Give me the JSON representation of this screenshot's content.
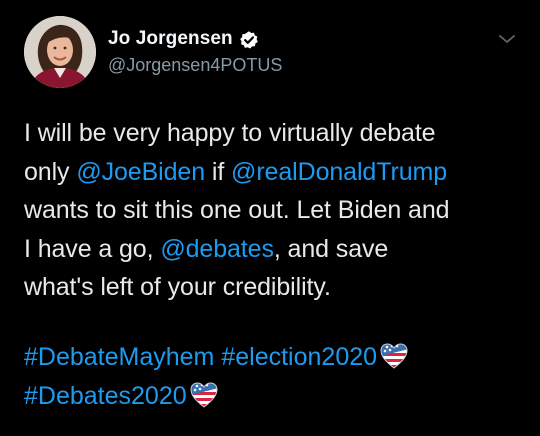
{
  "author": {
    "name": "Jo Jorgensen",
    "handle": "@Jorgensen4POTUS",
    "verified": true
  },
  "tweet": {
    "line1": "I will be very happy to virtually debate",
    "line2_pre": "only ",
    "mention1": "@JoeBiden",
    "line2_mid": " if ",
    "mention2": "@realDonaldTrump",
    "line3": "wants to sit this one out. Let Biden and",
    "line4_pre": "I have a go, ",
    "mention3": "@debates",
    "line4_post": ", and save",
    "line5": "what's left of your credibility."
  },
  "hashtags": {
    "tag1": "#DebateMayhem",
    "tag2": "#election2020",
    "tag3": "#Debates2020"
  },
  "icons": {
    "verified": "verified-badge-icon",
    "menu": "chevron-down-icon",
    "emoji": "usa-heart-emoji"
  },
  "colors": {
    "background": "#000000",
    "text": "#e7e9ea",
    "link": "#1d9bf0",
    "muted": "#8899a6"
  }
}
